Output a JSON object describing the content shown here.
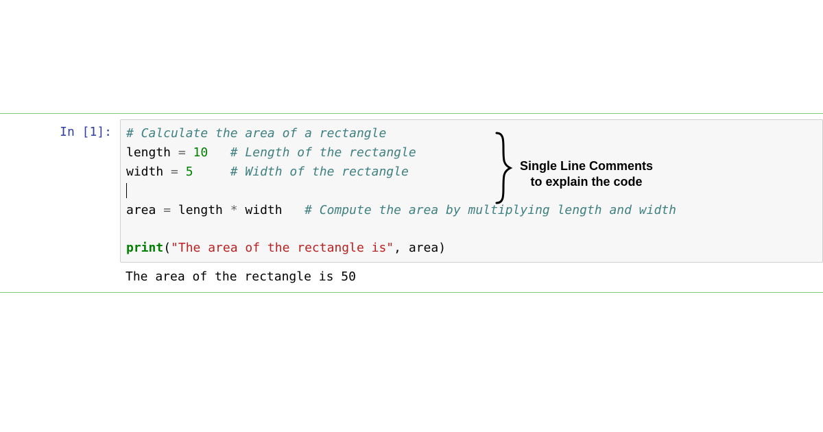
{
  "prompt": "In [1]:",
  "code": {
    "line1_comment": "# Calculate the area of a rectangle",
    "line2_var": "length",
    "line2_eq": " = ",
    "line2_num": "10",
    "line2_sp": "   ",
    "line2_comment": "# Length of the rectangle",
    "line3_var": "width",
    "line3_eq": " = ",
    "line3_num": "5",
    "line3_sp": "     ",
    "line3_comment": "# Width of the rectangle",
    "line5_var": "area",
    "line5_eq": " = ",
    "line5_a": "length",
    "line5_mul": " * ",
    "line5_b": "width",
    "line5_sp": "   ",
    "line5_comment": "# Compute the area by multiplying length and width",
    "line7_fn": "print",
    "line7_open": "(",
    "line7_str": "\"The area of the rectangle is\"",
    "line7_comma": ", ",
    "line7_arg": "area",
    "line7_close": ")"
  },
  "output": "The area of the rectangle is 50",
  "annotation": {
    "line1": "Single Line Comments",
    "line2": "to explain the code"
  }
}
